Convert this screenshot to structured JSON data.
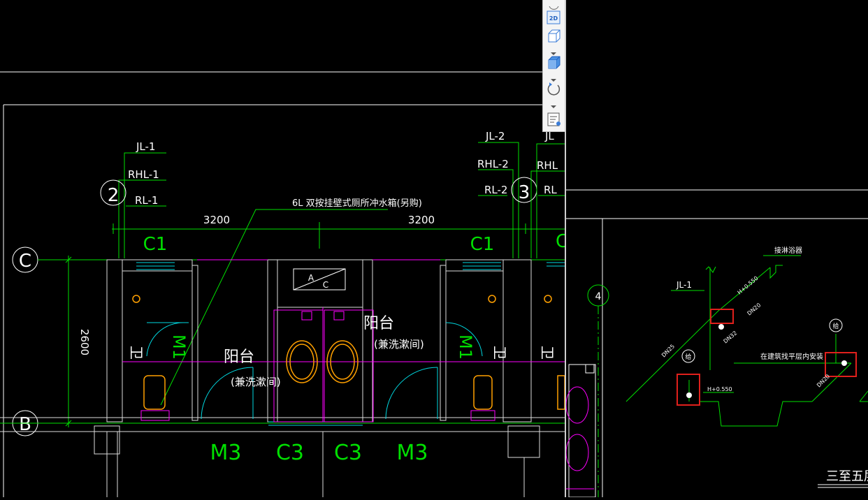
{
  "left_drawing": {
    "riser_labels_left": [
      "JL-1",
      "RHL-1",
      "RL-1"
    ],
    "riser_labels_right": [
      "JL-2",
      "RHL-2",
      "RL-2"
    ],
    "riser_labels_cut": [
      "JL",
      "RHL",
      "RL"
    ],
    "riser_symbol_left": "2",
    "riser_symbol_right": "3",
    "note": "6L 双按挂壁式厕所冲水箱(另购)",
    "dims": [
      "3200",
      "3200"
    ],
    "dim_vertical": "2600",
    "grid_axes": [
      "C",
      "B"
    ],
    "windows": [
      "C1",
      "C1"
    ],
    "window_cut": "C",
    "doors_bottom": [
      "M3",
      "C3",
      "C3",
      "M3"
    ],
    "door_m1": [
      "M1",
      "M1"
    ],
    "room_wei": [
      "卫",
      "卫",
      "卫"
    ],
    "room_left": {
      "name": "阳台",
      "sub": "(兼洗漱间)"
    },
    "room_right": {
      "name": "阳台",
      "sub": "(兼洗漱间)"
    },
    "center_box": [
      "A",
      "C"
    ]
  },
  "right_drawing": {
    "axis_number": "4",
    "label_jl": "JL-1",
    "label_shower": "接淋浴器",
    "label_install": "在建筑找平层内安装",
    "elevation_1": "H+0.550",
    "elevation_2": "H+0.550",
    "pipe_sizes": [
      "DN20",
      "DN32",
      "DN25",
      "DN20"
    ],
    "tag_1": "给",
    "tag_2": "给",
    "floor_title": "三至五层"
  },
  "toolbar": {
    "btn_2d": "2D"
  },
  "colors": {
    "background": "#000000",
    "green": "#00e000",
    "white": "#ffffff",
    "magenta": "#ff00ff",
    "cyan": "#00d8e0",
    "orange": "#ffa000",
    "highlight": "#e0201c"
  },
  "icons": [
    "2d-view-icon",
    "box-view-icon",
    "shaded-box-icon",
    "rotate-icon",
    "properties-icon"
  ]
}
